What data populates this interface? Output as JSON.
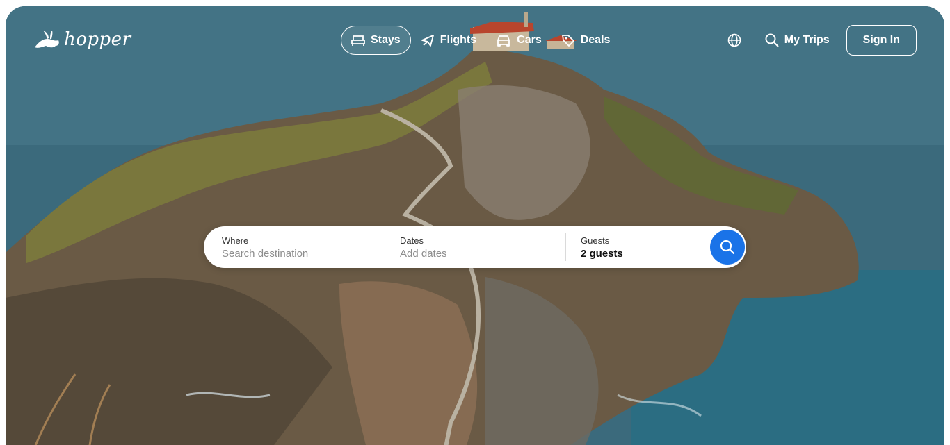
{
  "brand": {
    "name": "hopper",
    "logo_icon": "bunny-icon"
  },
  "nav": {
    "items": [
      {
        "label": "Stays",
        "icon": "bed-icon",
        "active": true
      },
      {
        "label": "Flights",
        "icon": "plane-icon",
        "active": false
      },
      {
        "label": "Cars",
        "icon": "car-icon",
        "active": false
      },
      {
        "label": "Deals",
        "icon": "tag-icon",
        "active": false
      }
    ]
  },
  "right_nav": {
    "language_icon": "globe-icon",
    "my_trips_label": "My Trips",
    "sign_in_label": "Sign In"
  },
  "search": {
    "where_label": "Where",
    "where_placeholder": "Search destination",
    "dates_label": "Dates",
    "dates_placeholder": "Add dates",
    "guests_label": "Guests",
    "guests_value": "2 guests",
    "button_icon": "search-icon"
  },
  "colors": {
    "accent": "#1a73e8",
    "text_on_hero": "#ffffff"
  }
}
